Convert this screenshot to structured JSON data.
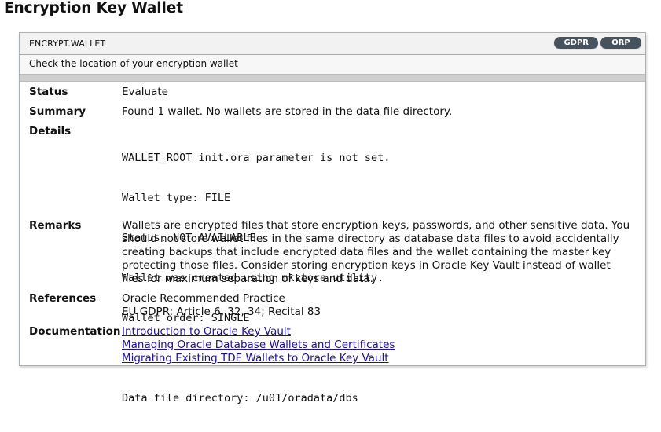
{
  "page": {
    "title": "Encryption Key Wallet"
  },
  "card": {
    "id": "ENCRYPT.WALLET",
    "tags": [
      "GDPR",
      "ORP"
    ],
    "subtitle": "Check the location of your encryption wallet"
  },
  "rows": {
    "status": {
      "label": "Status",
      "value": "Evaluate"
    },
    "summary": {
      "label": "Summary",
      "value": "Found 1 wallet. No wallets are stored in the data file directory."
    },
    "details": {
      "label": "Details",
      "lines": [
        "WALLET_ROOT init.ora parameter is not set.",
        "Wallet type: FILE",
        "Status: NOT_AVAILABLE",
        "Wallet was created using mkstore utility.",
        "Wallet order: SINGLE",
        "",
        "Data file directory: /u01/oradata/dbs"
      ]
    },
    "remarks": {
      "label": "Remarks",
      "lines": [
        "Wallets are encrypted files that store encryption keys, passwords, and other sensitive data. You",
        "should not store wallet files in the same directory as database data files to avoid accidentally",
        "creating backups that include encrypted data files and the wallet containing the master key",
        "protecting those files. Consider storing encryption keys in Oracle Key Vault instead of wallet",
        "files for maximum separation of keys and data."
      ]
    },
    "references": {
      "label": "References",
      "lines": [
        "Oracle Recommended Practice",
        "EU GDPR: Article 6, 32, 34; Recital 83"
      ]
    },
    "documentation": {
      "label": "Documentation",
      "links": [
        "Introduction to Oracle Key Vault",
        "Managing Oracle Database Wallets and Certificates",
        "Migrating Existing TDE Wallets to Oracle Key Vault"
      ]
    }
  }
}
